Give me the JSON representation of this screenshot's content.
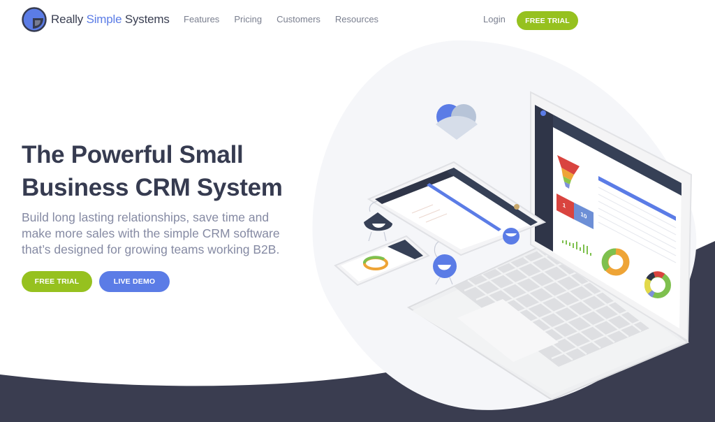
{
  "header": {
    "logo": {
      "prefix": "Really ",
      "accent": "Simple",
      "suffix": " Systems"
    },
    "nav": [
      {
        "label": "Features"
      },
      {
        "label": "Pricing"
      },
      {
        "label": "Customers"
      },
      {
        "label": "Resources"
      }
    ],
    "login_label": "Login",
    "free_trial_label": "FREE TRIAL"
  },
  "hero": {
    "title_line1": "The Powerful Small",
    "title_line2": "Business CRM System",
    "subtitle": "Build long lasting relationships, save time and make more sales with the simple CRM software that’s designed for growing teams working B2B.",
    "free_trial_label": "FREE TRIAL",
    "live_demo_label": "LIVE DEMO"
  },
  "illustration": {
    "laptop_screen": {
      "kpi_red_value": "1",
      "kpi_blue_value": "10"
    }
  },
  "colors": {
    "brand_blue": "#5b7ce6",
    "brand_green": "#96c11f",
    "dark_navy": "#363b50",
    "text_muted": "#858aa3",
    "footer_band": "#3a3d50"
  }
}
